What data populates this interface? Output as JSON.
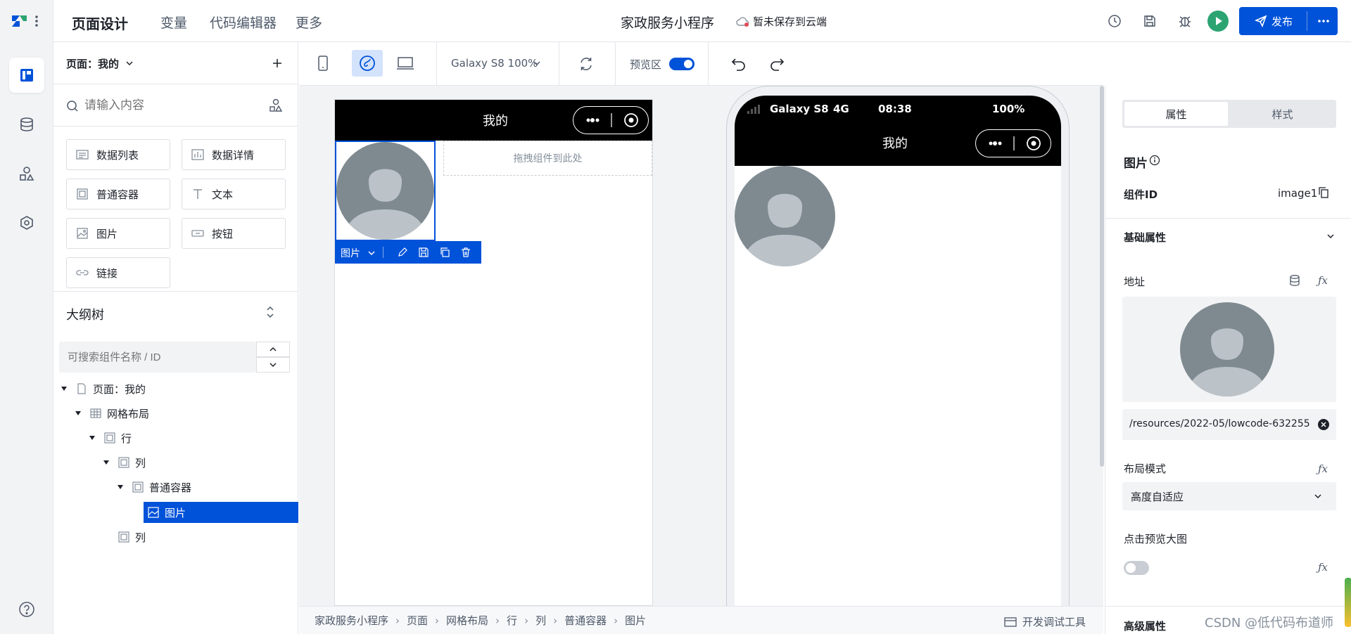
{
  "topbar": {
    "title": "页面设计",
    "nav": [
      "变量",
      "代码编辑器",
      "更多"
    ],
    "app_name": "家政服务小程序",
    "save_status": "暂未保存到云端",
    "publish_label": "发布"
  },
  "left_panel": {
    "page_selector": "页面：我的",
    "search_placeholder": "请输入内容",
    "components": [
      "数据列表",
      "数据详情",
      "普通容器",
      "文本",
      "图片",
      "按钮",
      "链接"
    ],
    "outline_title": "大纲树",
    "outline_search_placeholder": "可搜索组件名称 / ID",
    "tree": [
      "页面：我的",
      "网格布局",
      "行",
      "列",
      "普通容器",
      "图片",
      "列"
    ]
  },
  "toolbar": {
    "device_label": "Galaxy S8 100%",
    "preview_label": "预览区"
  },
  "editor": {
    "page_title": "我的",
    "drop_hint": "拖拽组件到此处",
    "selected_label": "图片"
  },
  "preview": {
    "carrier": "Galaxy S8",
    "network": "4G",
    "time": "08:38",
    "battery": "100%",
    "page_title": "我的"
  },
  "right_panel": {
    "tabs": [
      "属性",
      "样式"
    ],
    "component_type": "图片",
    "component_id_label": "组件ID",
    "component_id": "image1",
    "section_basic": "基础属性",
    "address_label": "地址",
    "address_value": "/resources/2022-05/lowcode-632255",
    "layout_label": "布局模式",
    "layout_value": "高度自适应",
    "click_preview_label": "点击预览大图",
    "section_advanced": "高级属性"
  },
  "breadcrumb": {
    "items": [
      "家政服务小程序",
      "页面",
      "网格布局",
      "行",
      "列",
      "普通容器",
      "图片"
    ],
    "dev_tools": "开发调试工具"
  },
  "watermark": "CSDN @低代码布道师",
  "colors": {
    "primary": "#0052d9",
    "avatar_bg": "#7f8a90",
    "avatar_fg": "#bcc3c8"
  }
}
